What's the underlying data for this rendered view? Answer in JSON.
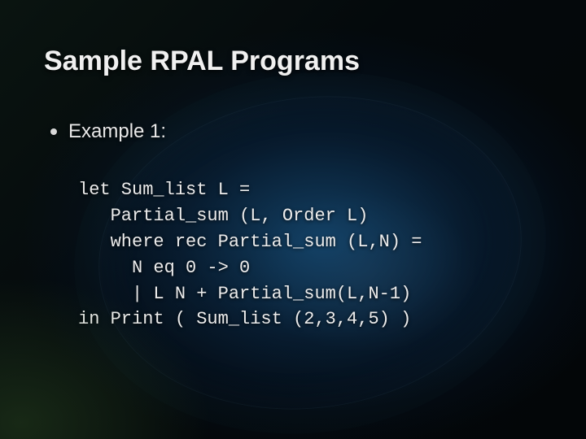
{
  "title": "Sample RPAL Programs",
  "bullet": "Example 1:",
  "code_lines": [
    "let Sum_list L =",
    "   Partial_sum (L, Order L)",
    "   where rec Partial_sum (L,N) =",
    "     N eq 0 -> 0",
    "     | L N + Partial_sum(L,N-1)",
    "in Print ( Sum_list (2,3,4,5) )"
  ]
}
